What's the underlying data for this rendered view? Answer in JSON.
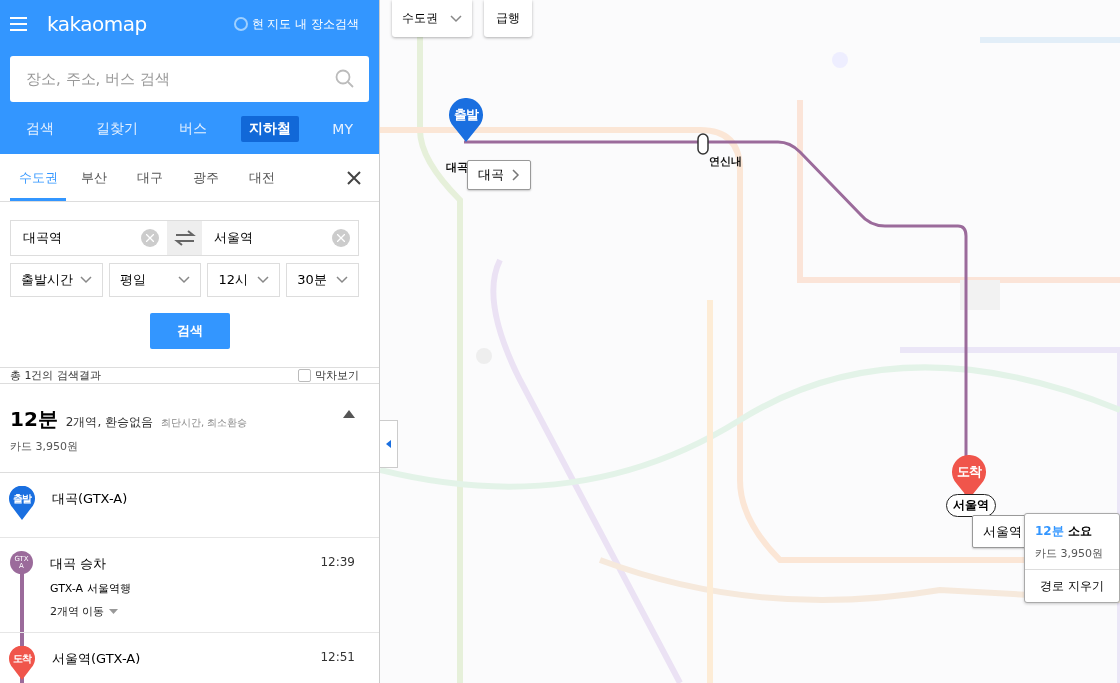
{
  "header": {
    "logo": "kakaomap",
    "nearby_search": {
      "label": "현 지도 내 장소검색",
      "checked": false
    },
    "search": {
      "placeholder": "장소, 주소, 버스 검색"
    },
    "nav_tabs": [
      {
        "label": "검색",
        "selected": false
      },
      {
        "label": "길찾기",
        "selected": false
      },
      {
        "label": "버스",
        "selected": false
      },
      {
        "label": "지하철",
        "selected": true
      },
      {
        "label": "MY",
        "selected": false
      }
    ]
  },
  "region_tabs": [
    {
      "label": "수도권",
      "selected": true
    },
    {
      "label": "부산",
      "selected": false
    },
    {
      "label": "대구",
      "selected": false
    },
    {
      "label": "광주",
      "selected": false
    },
    {
      "label": "대전",
      "selected": false
    }
  ],
  "route_form": {
    "origin": "대곡역",
    "destination": "서울역",
    "selects": [
      "출발시간",
      "평일",
      "12시",
      "30분"
    ],
    "search_button": "검색"
  },
  "results": {
    "summary": "총 1건의 검색결과",
    "last_train": {
      "label": "막차보기",
      "checked": false
    }
  },
  "route": {
    "duration": "12분",
    "stops": "2개역, 환승없음",
    "tags": "최단시간, 최소환승",
    "fare": "카드 3,950원",
    "expanded": true,
    "steps": [
      {
        "kind": "start",
        "badge": "출발",
        "name": "대곡(GTX-A)",
        "color": "#1a6fe0"
      },
      {
        "kind": "board",
        "badge": "GTX A",
        "color": "#9b6b9b",
        "name": "대곡 승차",
        "time": "12:39",
        "direction": "GTX-A 서울역행",
        "stations": "2개역 이동"
      },
      {
        "kind": "end",
        "badge": "도착",
        "name": "서울역(GTX-A)",
        "time": "12:51",
        "color": "#f0554b"
      }
    ]
  },
  "map": {
    "region_select": "수도권",
    "express": "급행",
    "start_pin": "출발",
    "start_station": "대곡",
    "start_tooltip": "대곡",
    "via_station": "연신내",
    "end_pin": "도착",
    "end_station": "서울역",
    "end_tooltip": "서울역",
    "popup": {
      "duration": "12분",
      "duration_suffix": "소요",
      "fare": "카드 3,950원",
      "clear": "경로 지우기"
    }
  }
}
